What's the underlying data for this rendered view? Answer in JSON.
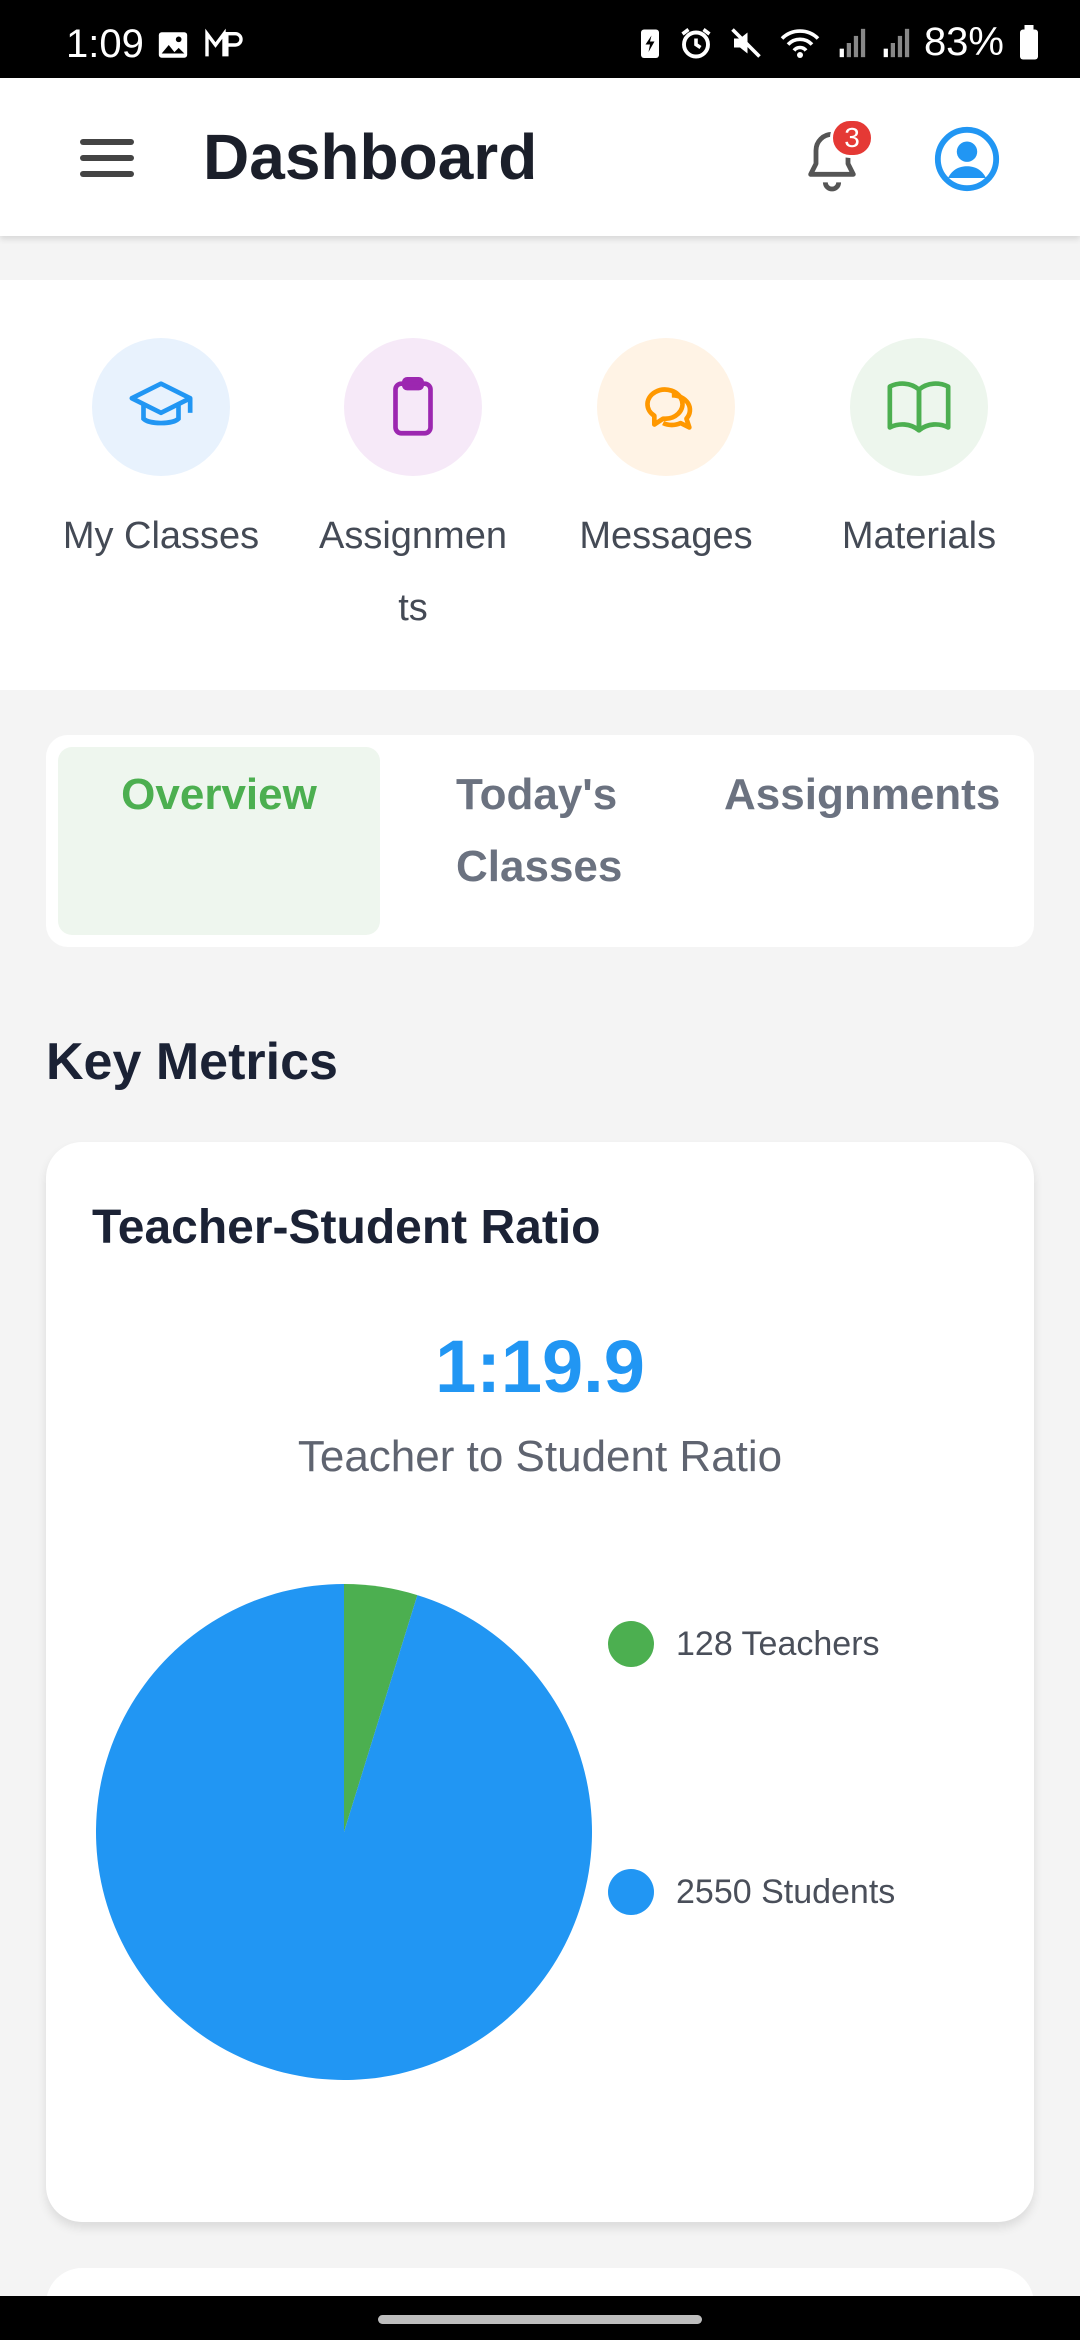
{
  "status_bar": {
    "time": "1:09",
    "battery": "83%",
    "icons": [
      "gallery-icon",
      "mp-icon",
      "battery-saver-icon",
      "alarm-icon",
      "mute-icon",
      "wifi-icon",
      "signal-icon",
      "signal-icon",
      "battery-icon"
    ]
  },
  "header": {
    "title": "Dashboard",
    "notification_count": "3",
    "icons": [
      "menu-icon",
      "bell-icon",
      "account-icon"
    ]
  },
  "quick_actions": [
    {
      "label": "My Classes",
      "icon": "graduation-cap-icon",
      "bg": "#e8f2fd",
      "color": "#2196f3"
    },
    {
      "label": "Assignmen",
      "label_line2": "ts",
      "icon": "clipboard-icon",
      "bg": "#f6e9f8",
      "color": "#9c27b0"
    },
    {
      "label": "Messages",
      "icon": "chat-bubbles-icon",
      "bg": "#fff3e5",
      "color": "#ff9800"
    },
    {
      "label": "Materials",
      "icon": "book-icon",
      "bg": "#edf6ed",
      "color": "#4caf50"
    }
  ],
  "tabs": [
    {
      "label": "Overview",
      "active": true
    },
    {
      "label": "Today's",
      "label_line2": "Classes",
      "active": false
    },
    {
      "label": "Assignments",
      "active": false
    }
  ],
  "section_title": "Key Metrics",
  "ratio_card": {
    "title": "Teacher-Student Ratio",
    "ratio": "1:19.9",
    "subtitle": "Teacher to Student Ratio",
    "legend": [
      {
        "label": "128 Teachers",
        "color": "#4caf50"
      },
      {
        "label": "2550 Students",
        "color": "#2196f3"
      }
    ]
  },
  "chart_data": {
    "type": "pie",
    "title": "",
    "series": [
      {
        "name": "128 Teachers",
        "values": [
          128
        ]
      },
      {
        "name": "2550 Students",
        "values": [
          2550
        ]
      }
    ],
    "colors": [
      "#4caf50",
      "#2196f3"
    ],
    "legend_position": "right"
  },
  "colors": {
    "accent_blue": "#2196f3",
    "accent_green": "#4caf50",
    "badge_red": "#e53935"
  }
}
